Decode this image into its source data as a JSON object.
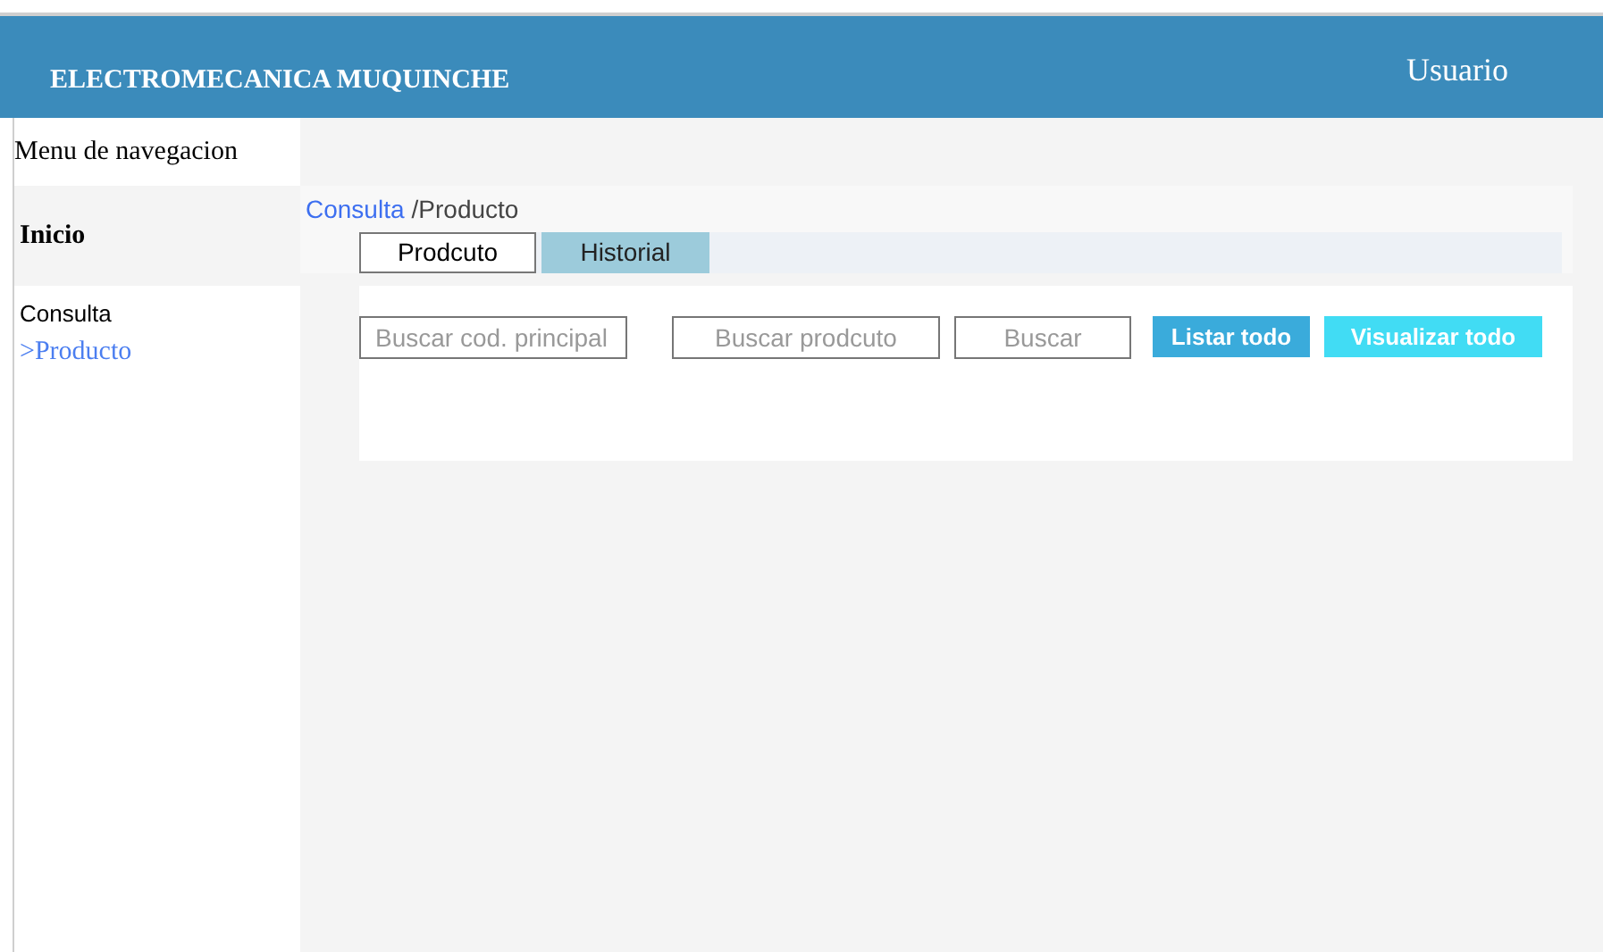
{
  "header": {
    "brand": "ELECTROMECANICA MUQUINCHE",
    "user": "Usuario"
  },
  "sidebar": {
    "title": "Menu de navegacion",
    "section": "Inicio",
    "items": [
      {
        "label": "Consulta",
        "kind": "group"
      },
      {
        "label": ">Producto",
        "kind": "link"
      }
    ]
  },
  "breadcrumb": [
    {
      "label": "Consulta",
      "kind": "link"
    },
    {
      "label": "/Producto",
      "kind": "current"
    }
  ],
  "tabs": [
    {
      "label": "Prodcuto",
      "selected": true
    },
    {
      "label": "Historial",
      "selected": false
    }
  ],
  "search": {
    "code_placeholder": "Buscar cod. principal",
    "product_placeholder": "Buscar prodcuto",
    "search_button": "Buscar",
    "list_button": "Listar todo",
    "view_button": "Visualizar todo"
  }
}
